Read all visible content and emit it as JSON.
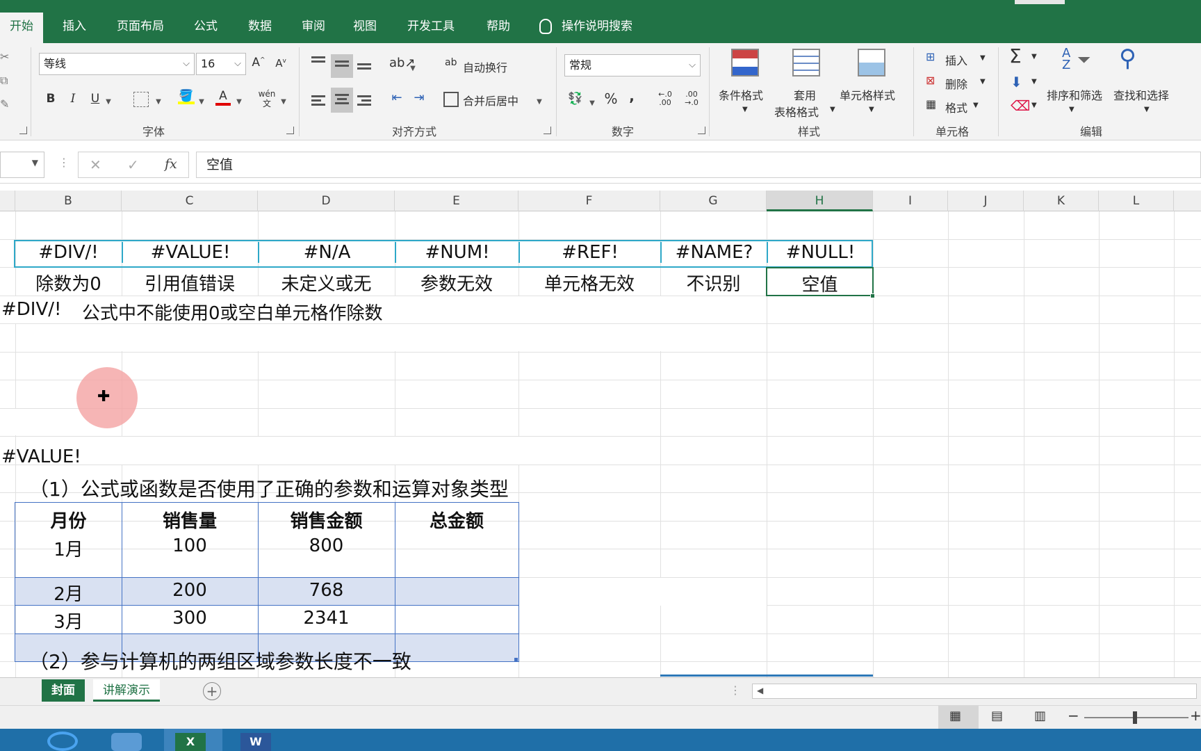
{
  "ribbon_tabs": [
    "开始",
    "插入",
    "页面布局",
    "公式",
    "数据",
    "审阅",
    "视图",
    "开发工具",
    "帮助"
  ],
  "tell_me": "操作说明搜索",
  "font": {
    "name": "等线",
    "size": "16",
    "grow_label": "A",
    "shrink_label": "A",
    "bold": "B",
    "italic": "I",
    "underline": "U",
    "font_color_label": "A",
    "phonetic_label": "wén",
    "group_label": "字体"
  },
  "alignment": {
    "wrap_label": "自动换行",
    "merge_label": "合并后居中",
    "wrap_icon_label": "ab",
    "group_label": "对齐方式"
  },
  "number": {
    "format": "常规",
    "percent": "%",
    "comma": ",",
    "inc_decimal": "←.0 .00",
    "dec_decimal": ".00 →.0",
    "group_label": "数字"
  },
  "styles": {
    "conditional_label": "条件格式",
    "table_label_1": "套用",
    "table_label_2": "表格格式",
    "cell_styles_label": "单元格样式",
    "group_label": "样式"
  },
  "cells": {
    "insert_label": "插入",
    "delete_label": "删除",
    "format_label": "格式",
    "group_label": "单元格"
  },
  "editing": {
    "sum_symbol": "Σ",
    "sort_label": "排序和筛选",
    "find_label": "查找和选择",
    "sort_icon_text": "A\nZ",
    "group_label": "编辑"
  },
  "formula_bar": {
    "cancel": "✕",
    "enter": "✓",
    "fx": "fx",
    "content": "空值"
  },
  "columns": [
    "B",
    "C",
    "D",
    "E",
    "F",
    "G",
    "H",
    "I",
    "J",
    "K",
    "L"
  ],
  "selected_column": "H",
  "error_table": {
    "codes": [
      "#DIV/!",
      "#VALUE!",
      "#N/A",
      "#NUM!",
      "#REF!",
      "#NAME?",
      "#NULL!"
    ],
    "meanings": [
      "除数为0",
      "引用值错误",
      "未定义或无",
      "参数无效",
      "单元格无效",
      "不识别",
      "空值"
    ]
  },
  "div_note_code": "#DIV/!",
  "div_note_text": "公式中不能使用0或空白单元格作除数",
  "value_heading": "#VALUE!",
  "value_point_1": "（1）公式或函数是否使用了正确的参数和运算对象类型",
  "sales_table": {
    "headers": [
      "月份",
      "销售量",
      "销售金额",
      "总金额"
    ],
    "rows": [
      [
        "1月",
        "100",
        "800",
        ""
      ],
      [
        "2月",
        "200",
        "768",
        ""
      ],
      [
        "3月",
        "300",
        "2341",
        ""
      ]
    ]
  },
  "value_point_2": "（2）参与计算机的两组区域参数长度不一致",
  "sheet_tabs": [
    "封面",
    "讲解演示"
  ],
  "active_sheet": "封面",
  "add_sheet": "+",
  "status": {
    "zoom_minus": "−",
    "zoom_plus": "+"
  },
  "colors": {
    "excel_green": "#217346",
    "table_band": "#d9e1f2",
    "error_table_border": "#2ea8c8",
    "sales_table_border": "#4472c4",
    "cursor_highlight": "#f4a3a3"
  }
}
